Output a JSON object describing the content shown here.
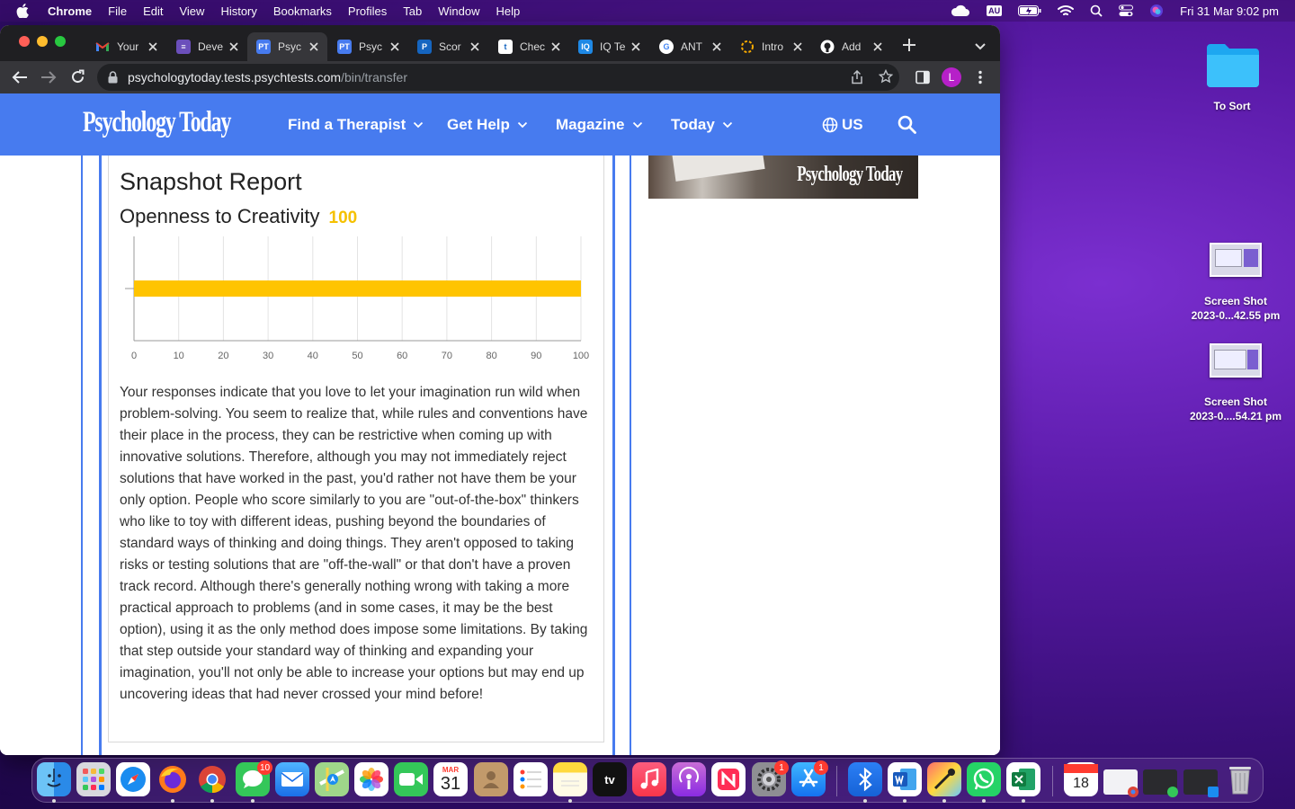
{
  "menubar": {
    "app": "Chrome",
    "items": [
      "File",
      "Edit",
      "View",
      "History",
      "Bookmarks",
      "Profiles",
      "Tab",
      "Window",
      "Help"
    ],
    "input_source": "AU",
    "clock": "Fri 31 Mar  9:02 pm"
  },
  "browser": {
    "tabs": [
      {
        "title": "Your",
        "icon": "gmail-icon",
        "color": "#ffffff"
      },
      {
        "title": "Deve",
        "icon": "list-icon",
        "color": "#6b4fbb"
      },
      {
        "title": "Psyc",
        "icon": "pt-icon",
        "color": "#477bef"
      },
      {
        "title": "Psyc",
        "icon": "pt-icon",
        "color": "#477bef"
      },
      {
        "title": "Scor",
        "icon": "p-icon",
        "color": "#1565c0"
      },
      {
        "title": "Chec",
        "icon": "t-icon",
        "color": "#ffffff"
      },
      {
        "title": "IQ Te",
        "icon": "iq-icon",
        "color": "#1e88e5"
      },
      {
        "title": "ANT",
        "icon": "google-icon",
        "color": "#ffffff"
      },
      {
        "title": "Intro",
        "icon": "colab-icon",
        "color": "#f9ab00"
      },
      {
        "title": "Add",
        "icon": "github-icon",
        "color": "#ffffff"
      }
    ],
    "url_host": "psychologytoday.tests.psychtests.com",
    "url_path": "/bin/transfer",
    "profile_initial": "L"
  },
  "site": {
    "logo": "Psychology Today",
    "nav": [
      "Find a Therapist",
      "Get Help",
      "Magazine",
      "Today"
    ],
    "region": "US"
  },
  "report": {
    "heading": "Snapshot Report",
    "trait": "Openness to Creativity",
    "score": "100",
    "body": "Your responses indicate that you love to let your imagination run wild when problem-solving. You seem to realize that, while rules and conventions have their place in the process, they can be restrictive when coming up with innovative solutions. Therefore, although you may not immediately reject solutions that have worked in the past, you'd rather not have them be your only option. People who score similarly to you are \"out-of-the-box\" thinkers who like to toy with different ideas, pushing beyond the boundaries of standard ways of thinking and doing things. They aren't opposed to taking risks or testing solutions that are \"off-the-wall\" or that don't have a proven track record. Although there's generally nothing wrong with taking a more practical approach to problems (and in some cases, it may be the best option), using it as the only method does impose some limitations. By taking that step outside your standard way of thinking and expanding your imagination, you'll not only be able to increase your options but may end up uncovering ideas that had never crossed your mind before!"
  },
  "ad": {
    "logo": "Psychology Today"
  },
  "chart_data": {
    "type": "bar",
    "orientation": "horizontal",
    "categories": [
      ""
    ],
    "values": [
      100
    ],
    "xlim": [
      0,
      100
    ],
    "xticks": [
      0,
      10,
      20,
      30,
      40,
      50,
      60,
      70,
      80,
      90,
      100
    ],
    "bar_color": "#ffc400",
    "grid": true
  },
  "desktop": {
    "folder": "To Sort",
    "screenshots": [
      {
        "line1": "Screen Shot",
        "line2": "2023-0...42.55 pm"
      },
      {
        "line1": "Screen Shot",
        "line2": "2023-0....54.21 pm"
      }
    ]
  },
  "dock": {
    "messages_badge": "10",
    "settings_badge": "1",
    "appstore_badge": "1",
    "calendar_month": "MAR",
    "calendar_day": "31",
    "recent_calendar_day": "18",
    "appletv_label": "tv"
  }
}
